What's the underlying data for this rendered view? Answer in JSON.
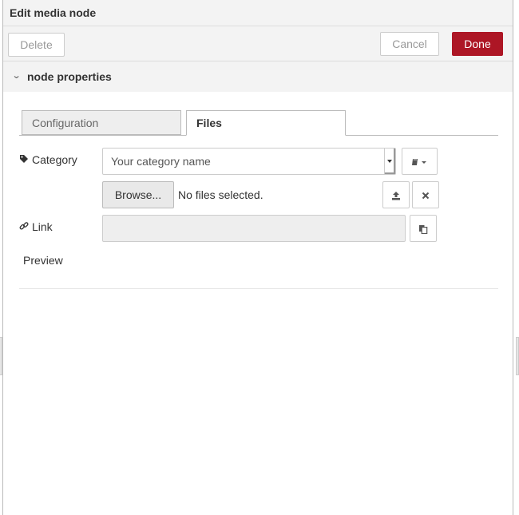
{
  "tray": {
    "title": "Edit media node"
  },
  "toolbar": {
    "delete_label": "Delete",
    "cancel_label": "Cancel",
    "done_label": "Done"
  },
  "section": {
    "title": "node properties"
  },
  "tabs": [
    {
      "label": "Configuration",
      "active": false
    },
    {
      "label": "Files",
      "active": true
    }
  ],
  "form": {
    "category": {
      "label": "Category",
      "placeholder": "Your category name",
      "menu_icon": "book-icon"
    },
    "file": {
      "browse_label": "Browse...",
      "status": "No files selected."
    },
    "link": {
      "label": "Link",
      "value": ""
    },
    "preview": {
      "label": "Preview"
    }
  },
  "colors": {
    "accent": "#ad1625",
    "header_bg": "#f3f3f3",
    "tab_inactive_bg": "#eeeeee"
  }
}
